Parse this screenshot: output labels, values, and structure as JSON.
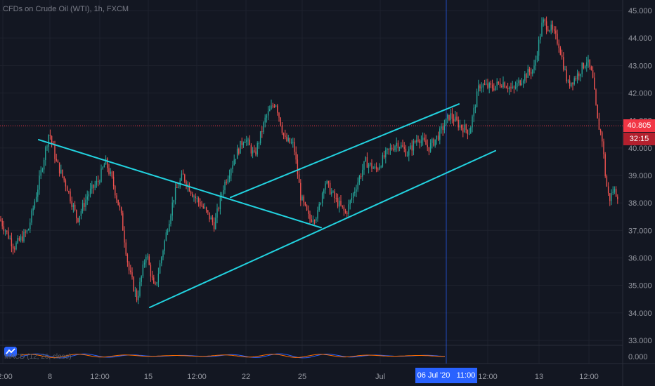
{
  "title": "CFDs on Crude Oil (WTI), 1h, FXCM",
  "oscillator_label": "MACD (12, 26, close)",
  "oscillator_zero_label": "0.000",
  "colors": {
    "background": "#131722",
    "grid": "#1e222d",
    "up": "#26a69a",
    "down": "#ef5350",
    "trendline": "#22d3e0",
    "price_line": "#f23645",
    "crosshair": "#2962ff",
    "macd": "#2962ff",
    "signal": "#ff6d00"
  },
  "price_tag": {
    "price": "40.805",
    "countdown": "32:15"
  },
  "crosshair_tag": {
    "date": "06 Jul '20",
    "time": "11:00"
  },
  "chart_data": {
    "type": "candlestick",
    "symbol": "CFDs on Crude Oil (WTI)",
    "interval": "1h",
    "source": "FXCM",
    "y_ticks": [
      "33.000",
      "34.000",
      "35.000",
      "36.000",
      "37.000",
      "38.000",
      "39.000",
      "40.000",
      "41.000",
      "42.000",
      "43.000",
      "44.000",
      "45.000"
    ],
    "x_ticks": [
      "12:00",
      "8",
      "12:00",
      "15",
      "12:00",
      "22",
      "25",
      "Jul",
      "12:00",
      "12:00",
      "13",
      "12:00"
    ],
    "ylim": [
      32.8,
      45.3
    ],
    "last_price": 40.805,
    "price_path": [
      [
        0,
        37.4
      ],
      [
        20,
        36.4
      ],
      [
        40,
        37.0
      ],
      [
        55,
        38.7
      ],
      [
        70,
        40.6
      ],
      [
        80,
        39.5
      ],
      [
        95,
        38.6
      ],
      [
        110,
        37.4
      ],
      [
        125,
        38.3
      ],
      [
        140,
        38.8
      ],
      [
        150,
        39.5
      ],
      [
        160,
        38.8
      ],
      [
        172,
        37.6
      ],
      [
        183,
        35.6
      ],
      [
        195,
        34.5
      ],
      [
        208,
        36.2
      ],
      [
        220,
        34.8
      ],
      [
        235,
        36.7
      ],
      [
        248,
        38.3
      ],
      [
        260,
        39.0
      ],
      [
        275,
        38.3
      ],
      [
        290,
        37.8
      ],
      [
        305,
        37.2
      ],
      [
        318,
        38.6
      ],
      [
        333,
        39.6
      ],
      [
        348,
        40.4
      ],
      [
        362,
        39.7
      ],
      [
        378,
        41.1
      ],
      [
        392,
        41.7
      ],
      [
        405,
        40.3
      ],
      [
        418,
        40.1
      ],
      [
        428,
        38.2
      ],
      [
        440,
        37.4
      ],
      [
        452,
        37.6
      ],
      [
        462,
        38.8
      ],
      [
        478,
        38.1
      ],
      [
        492,
        37.6
      ],
      [
        505,
        38.5
      ],
      [
        520,
        39.5
      ],
      [
        535,
        39.2
      ],
      [
        550,
        39.8
      ],
      [
        565,
        40.2
      ],
      [
        580,
        39.8
      ],
      [
        595,
        40.4
      ],
      [
        610,
        40.0
      ],
      [
        625,
        40.5
      ],
      [
        640,
        41.2
      ],
      [
        655,
        40.8
      ],
      [
        668,
        40.6
      ],
      [
        682,
        42.3
      ],
      [
        700,
        42.2
      ],
      [
        715,
        42.4
      ],
      [
        730,
        42.1
      ],
      [
        745,
        42.6
      ],
      [
        760,
        42.9
      ],
      [
        772,
        44.6
      ],
      [
        785,
        44.3
      ],
      [
        795,
        43.8
      ],
      [
        808,
        42.3
      ],
      [
        820,
        42.6
      ],
      [
        835,
        43.2
      ],
      [
        843,
        42.6
      ],
      [
        850,
        41.0
      ],
      [
        857,
        40.3
      ],
      [
        862,
        38.8
      ],
      [
        867,
        38.1
      ],
      [
        873,
        38.5
      ],
      [
        878,
        38.3
      ]
    ],
    "trendlines": [
      {
        "name": "descending-line",
        "from": [
          55,
          40.3
        ],
        "to": [
          457,
          37.1
        ]
      },
      {
        "name": "lower-channel-line",
        "from": [
          213,
          34.2
        ],
        "to": [
          705,
          39.9
        ]
      },
      {
        "name": "upper-channel-line",
        "from": [
          328,
          38.2
        ],
        "to": [
          653,
          41.6
        ]
      }
    ]
  }
}
